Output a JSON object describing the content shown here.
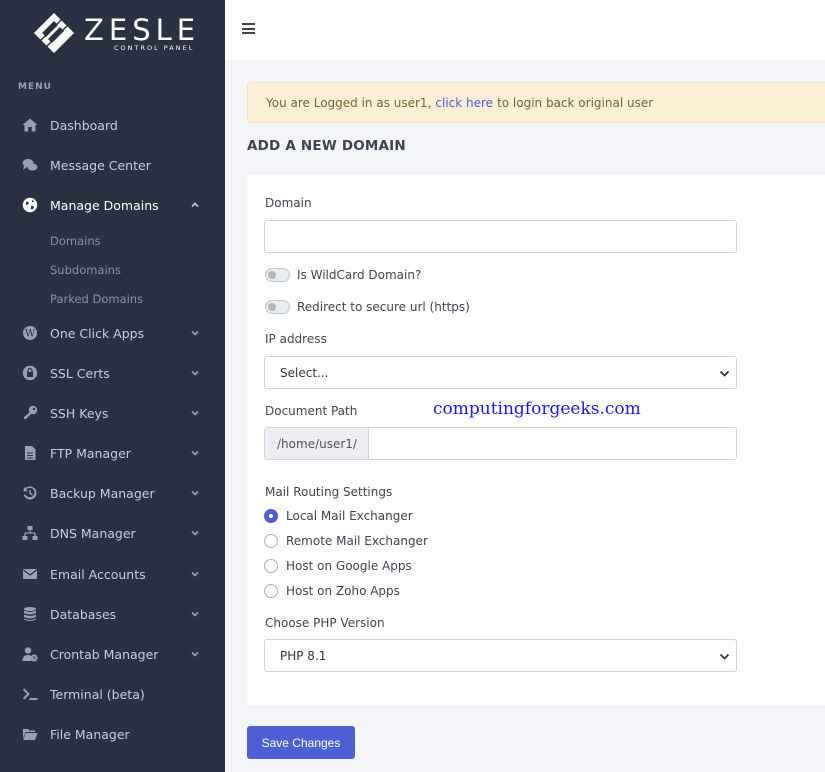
{
  "app": {
    "logo_name": "ZESLE",
    "logo_sub": "CONTROL PANEL"
  },
  "sidebar": {
    "menu_heading": "MENU",
    "items": [
      {
        "label": "Dashboard",
        "icon": "home-icon"
      },
      {
        "label": "Message Center",
        "icon": "chat-icon"
      },
      {
        "label": "Manage Domains",
        "icon": "globe-icon",
        "expanded": true
      },
      {
        "label": "One Click Apps",
        "icon": "wordpress-icon"
      },
      {
        "label": "SSL Certs",
        "icon": "lock-icon"
      },
      {
        "label": "SSH Keys",
        "icon": "key-icon"
      },
      {
        "label": "FTP Manager",
        "icon": "file-icon"
      },
      {
        "label": "Backup Manager",
        "icon": "history-icon"
      },
      {
        "label": "DNS Manager",
        "icon": "network-icon"
      },
      {
        "label": "Email Accounts",
        "icon": "envelope-icon"
      },
      {
        "label": "Databases",
        "icon": "database-icon"
      },
      {
        "label": "Crontab Manager",
        "icon": "user-clock-icon"
      },
      {
        "label": "Terminal (beta)",
        "icon": "terminal-icon"
      },
      {
        "label": "File Manager",
        "icon": "folder-icon"
      }
    ],
    "subitems": [
      "Domains",
      "Subdomains",
      "Parked Domains"
    ]
  },
  "alert": {
    "prefix": "You are Logged in as user1,",
    "link": "click here",
    "suffix": "to login back original user"
  },
  "page_title": "ADD A NEW DOMAIN",
  "form": {
    "domain_label": "Domain",
    "domain_value": "",
    "wildcard_label": "Is WildCard Domain?",
    "wildcard_on": false,
    "redirect_label": "Redirect to secure url (https)",
    "redirect_on": false,
    "ip_label": "IP address",
    "ip_selected": "Select...",
    "docpath_label": "Document Path",
    "docpath_prefix": "/home/user1/",
    "docpath_value": "",
    "mail_label": "Mail Routing Settings",
    "mail_options": [
      "Local Mail Exchanger",
      "Remote Mail Exchanger",
      "Host on Google Apps",
      "Host on Zoho Apps"
    ],
    "mail_selected_index": 0,
    "php_label": "Choose PHP Version",
    "php_selected": "PHP 8.1",
    "save_label": "Save Changes"
  },
  "watermark": "computingforgeeks.com",
  "colors": {
    "sidebar": "#2a3142",
    "accent": "#4e5fd6",
    "alert_bg": "#fcefd6"
  }
}
